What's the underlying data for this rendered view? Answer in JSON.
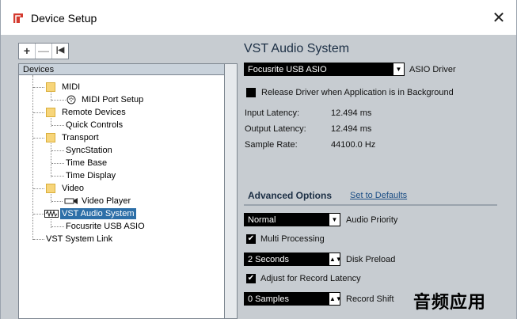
{
  "window": {
    "title": "Device Setup",
    "close_glyph": "✕"
  },
  "toolbar": {
    "add_label": "+",
    "remove_label": "—",
    "reset_label": "|◀"
  },
  "tree": {
    "header": "Devices",
    "items": {
      "midi": "MIDI",
      "midi_port_setup": "MIDI Port Setup",
      "remote_devices": "Remote Devices",
      "quick_controls": "Quick Controls",
      "transport": "Transport",
      "syncstation": "SyncStation",
      "time_base": "Time Base",
      "time_display": "Time Display",
      "video": "Video",
      "video_player": "Video Player",
      "vst_audio_system": "VST Audio System",
      "focusrite_usb_asio": "Focusrite USB ASIO",
      "vst_system_link": "VST System Link"
    }
  },
  "vst": {
    "title": "VST Audio System",
    "driver_value": "Focusrite USB ASIO",
    "driver_label": "ASIO Driver",
    "release_driver_label": "Release Driver when Application is in Background",
    "input_latency_label": "Input Latency:",
    "input_latency_value": "12.494 ms",
    "output_latency_label": "Output Latency:",
    "output_latency_value": "12.494 ms",
    "sample_rate_label": "Sample Rate:",
    "sample_rate_value": "44100.0 Hz"
  },
  "advanced": {
    "title": "Advanced Options",
    "defaults_link": "Set to Defaults",
    "audio_priority_value": "Normal",
    "audio_priority_label": "Audio Priority",
    "multi_processing_label": "Multi Processing",
    "disk_preload_value": "2 Seconds",
    "disk_preload_label": "Disk Preload",
    "adjust_latency_label": "Adjust for Record Latency",
    "record_shift_value": "0 Samples",
    "record_shift_label": "Record Shift",
    "check_glyph": "✔"
  },
  "watermark": "音频应用",
  "colors": {
    "selected": "#2d6fa8",
    "folder": "#f7d57a",
    "panel_bg": "#c7ccd1"
  }
}
